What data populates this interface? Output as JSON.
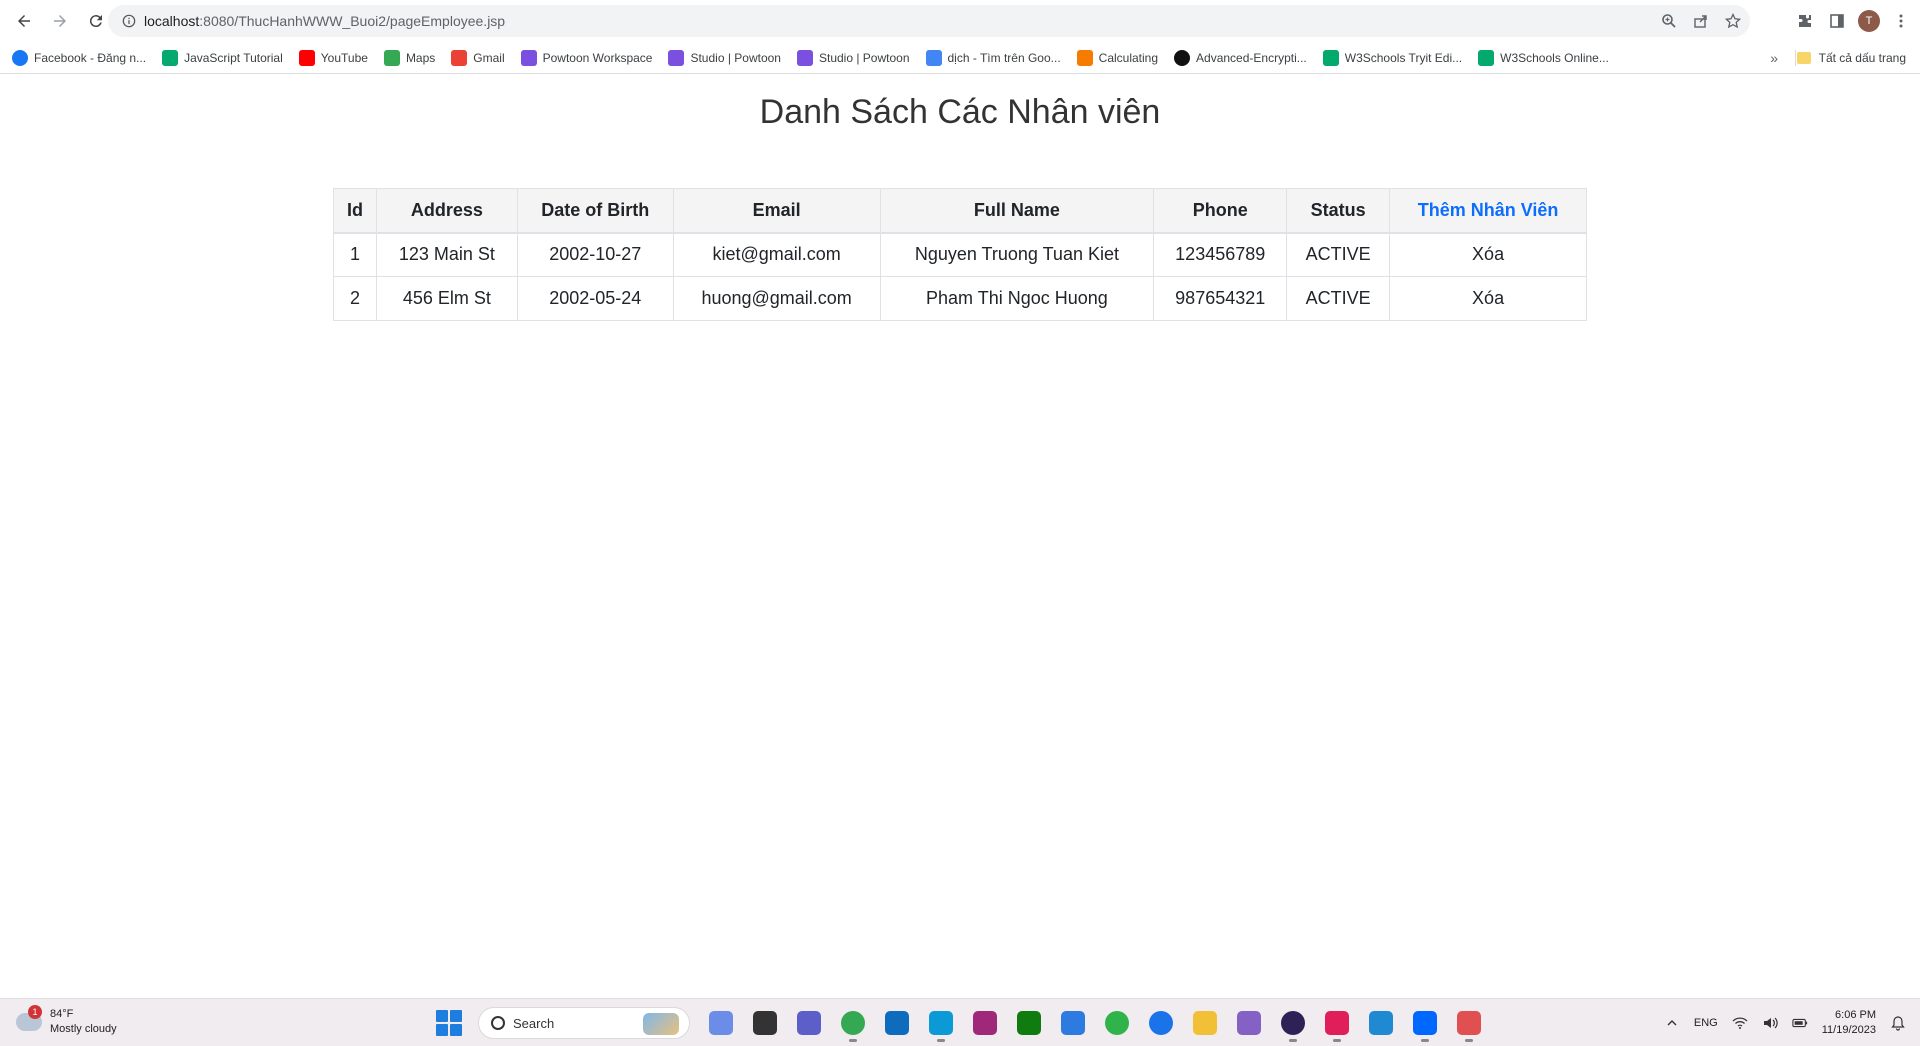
{
  "browser": {
    "url_host": "localhost",
    "url_path": ":8080/ThucHanhWWW_Buoi2/pageEmployee.jsp",
    "bookmarks": [
      {
        "label": "Facebook - Đăng n...",
        "icon": "facebook-icon",
        "color": "#1877f2"
      },
      {
        "label": "JavaScript Tutorial",
        "icon": "w3schools-icon",
        "color": "#04aa6d"
      },
      {
        "label": "YouTube",
        "icon": "youtube-icon",
        "color": "#ff0000"
      },
      {
        "label": "Maps",
        "icon": "maps-icon",
        "color": "#34a853"
      },
      {
        "label": "Gmail",
        "icon": "gmail-icon",
        "color": "#ea4335"
      },
      {
        "label": "Powtoon Workspace",
        "icon": "powtoon-icon",
        "color": "#7b4fe0"
      },
      {
        "label": "Studio | Powtoon",
        "icon": "powtoon-icon",
        "color": "#7b4fe0"
      },
      {
        "label": "Studio | Powtoon",
        "icon": "powtoon-icon",
        "color": "#7b4fe0"
      },
      {
        "label": "dịch - Tìm trên Goo...",
        "icon": "google-icon",
        "color": "#4285f4"
      },
      {
        "label": "Calculating",
        "icon": "pumpkin-icon",
        "color": "#f57c00"
      },
      {
        "label": "Advanced-Encrypti...",
        "icon": "github-icon",
        "color": "#111111"
      },
      {
        "label": "W3Schools Tryit Edi...",
        "icon": "w3schools-icon",
        "color": "#04aa6d"
      },
      {
        "label": "W3Schools Online...",
        "icon": "w3schools-icon",
        "color": "#04aa6d"
      }
    ],
    "more_label": "»",
    "all_bookmarks_label": "Tất cả dấu trang",
    "profile_initial": "T"
  },
  "page": {
    "title": "Danh Sách Các Nhân viên",
    "table": {
      "headers": {
        "id": "Id",
        "address": "Address",
        "dob": "Date of Birth",
        "email": "Email",
        "full_name": "Full Name",
        "phone": "Phone",
        "status": "Status",
        "add_link": "Thêm Nhân Viên"
      },
      "rows": [
        {
          "id": "1",
          "address": "123 Main St",
          "dob": "2002-10-27",
          "email": "kiet@gmail.com",
          "full_name": "Nguyen Truong Tuan Kiet",
          "phone": "123456789",
          "status": "ACTIVE",
          "action": "Xóa"
        },
        {
          "id": "2",
          "address": "456 Elm St",
          "dob": "2002-05-24",
          "email": "huong@gmail.com",
          "full_name": "Pham Thi Ngoc Huong",
          "phone": "987654321",
          "status": "ACTIVE",
          "action": "Xóa"
        }
      ]
    },
    "link_color": "#0d6efd"
  },
  "taskbar": {
    "weather_temp": "84°F",
    "weather_desc": "Mostly cloudy",
    "weather_badge": "1",
    "search_label": "Search",
    "language": "ENG",
    "time": "6:06 PM",
    "date": "11/19/2023",
    "apps": [
      {
        "name": "copilot-icon",
        "color": "#6b8de8"
      },
      {
        "name": "file-manager-icon",
        "color": "#333333"
      },
      {
        "name": "teams-icon",
        "color": "#5b5fc7"
      },
      {
        "name": "chrome-icon",
        "color": "#34a853"
      },
      {
        "name": "mail-icon",
        "color": "#0f6cbd"
      },
      {
        "name": "edge-icon",
        "color": "#0c9ad6"
      },
      {
        "name": "app-icon",
        "color": "#a0287a"
      },
      {
        "name": "xbox-icon",
        "color": "#107c10"
      },
      {
        "name": "cube-icon",
        "color": "#2d7be0"
      },
      {
        "name": "circle-app-icon",
        "color": "#2fb34a"
      },
      {
        "name": "zalo-z-icon",
        "color": "#1a73e8"
      },
      {
        "name": "folder-icon",
        "color": "#f2c037"
      },
      {
        "name": "visual-studio-icon",
        "color": "#8661c5"
      },
      {
        "name": "eclipse-icon",
        "color": "#2c2255"
      },
      {
        "name": "intellij-icon",
        "color": "#e01e5a"
      },
      {
        "name": "vscode-icon",
        "color": "#1f8ad2"
      },
      {
        "name": "zalo-icon",
        "color": "#0068ff"
      },
      {
        "name": "snipping-tool-icon",
        "color": "#e05050"
      }
    ]
  }
}
